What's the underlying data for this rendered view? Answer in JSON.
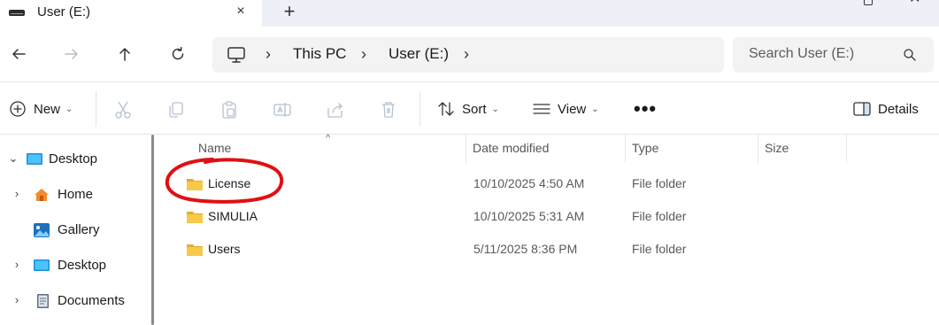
{
  "window": {
    "tab_title": "User (E:)",
    "close_tab_glyph": "×",
    "new_tab_glyph": "+"
  },
  "address": {
    "crumbs": [
      "This PC",
      "User (E:)"
    ],
    "separator": "›"
  },
  "search": {
    "placeholder": "Search User (E:)"
  },
  "toolbar": {
    "new_label": "New",
    "sort_label": "Sort",
    "view_label": "View",
    "more_glyph": "•••",
    "details_label": "Details",
    "caret": "⌄"
  },
  "sidebar": {
    "items": [
      {
        "label": "Desktop",
        "icon": "desktop-icon",
        "chevron": "⌄"
      },
      {
        "label": "Home",
        "icon": "home-icon",
        "chevron": "›"
      },
      {
        "label": "Gallery",
        "icon": "gallery-icon",
        "chevron": ""
      },
      {
        "label": "Desktop",
        "icon": "desktop-icon",
        "chevron": "›"
      },
      {
        "label": "Documents",
        "icon": "documents-icon",
        "chevron": "›"
      }
    ]
  },
  "filelist": {
    "columns": {
      "name": "Name",
      "date": "Date modified",
      "type": "Type",
      "size": "Size"
    },
    "sort_glyph": "^",
    "rows": [
      {
        "name": "License",
        "date": "10/10/2025 4:50 AM",
        "type": "File folder",
        "size": ""
      },
      {
        "name": "SIMULIA",
        "date": "10/10/2025 5:31 AM",
        "type": "File folder",
        "size": ""
      },
      {
        "name": "Users",
        "date": "5/11/2025 8:36 PM",
        "type": "File folder",
        "size": ""
      }
    ]
  },
  "colors": {
    "folder": "#f7c948",
    "folder_dark": "#e8aa2a",
    "annotation": "#e01010",
    "accent": "#0067c0"
  }
}
